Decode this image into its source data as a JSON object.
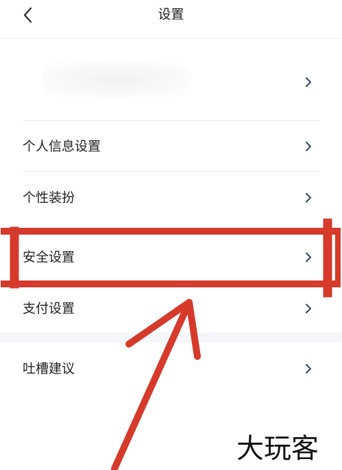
{
  "header": {
    "title": "设置",
    "back_icon": "chevron-left-icon"
  },
  "profile": {
    "chevron_icon": "chevron-right-icon"
  },
  "menu": {
    "items": [
      {
        "label": "个人信息设置"
      },
      {
        "label": "个性装扮"
      },
      {
        "label": "安全设置"
      },
      {
        "label": "支付设置"
      },
      {
        "label": "吐槽建议"
      }
    ]
  },
  "annotation": {
    "highlight_color": "#d63a2b",
    "highlighted_item": "安全设置"
  },
  "watermark": {
    "text": "大玩客"
  },
  "colors": {
    "chevron": "#2e4463",
    "divider": "#ececec",
    "section_gap": "#f4f6fa"
  }
}
